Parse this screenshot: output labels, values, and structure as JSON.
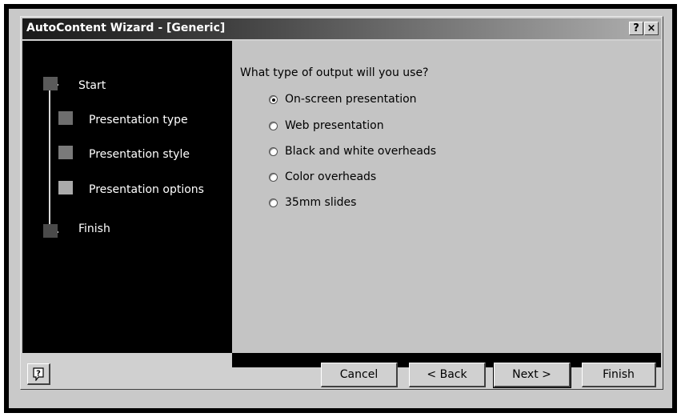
{
  "window": {
    "title": "AutoContent Wizard - [Generic]",
    "help_button": "?",
    "close_button": "×"
  },
  "steps": [
    {
      "label": "Start",
      "color": "#5a5a5a"
    },
    {
      "label": "Presentation type",
      "color": "#6e6e6e"
    },
    {
      "label": "Presentation style",
      "color": "#7a7a7a"
    },
    {
      "label": "Presentation options",
      "color": "#aaaaaa"
    },
    {
      "label": "Finish",
      "color": "#4a4a4a"
    }
  ],
  "content": {
    "question": "What type of output will you use?",
    "options": [
      {
        "label": "On-screen presentation",
        "selected": true
      },
      {
        "label": "Web presentation",
        "selected": false
      },
      {
        "label": "Black and white overheads",
        "selected": false
      },
      {
        "label": "Color overheads",
        "selected": false
      },
      {
        "label": "35mm slides",
        "selected": false
      }
    ]
  },
  "buttons": {
    "help_icon": "help-balloon-icon",
    "cancel": "Cancel",
    "back": "< Back",
    "next": "Next >",
    "finish": "Finish"
  }
}
